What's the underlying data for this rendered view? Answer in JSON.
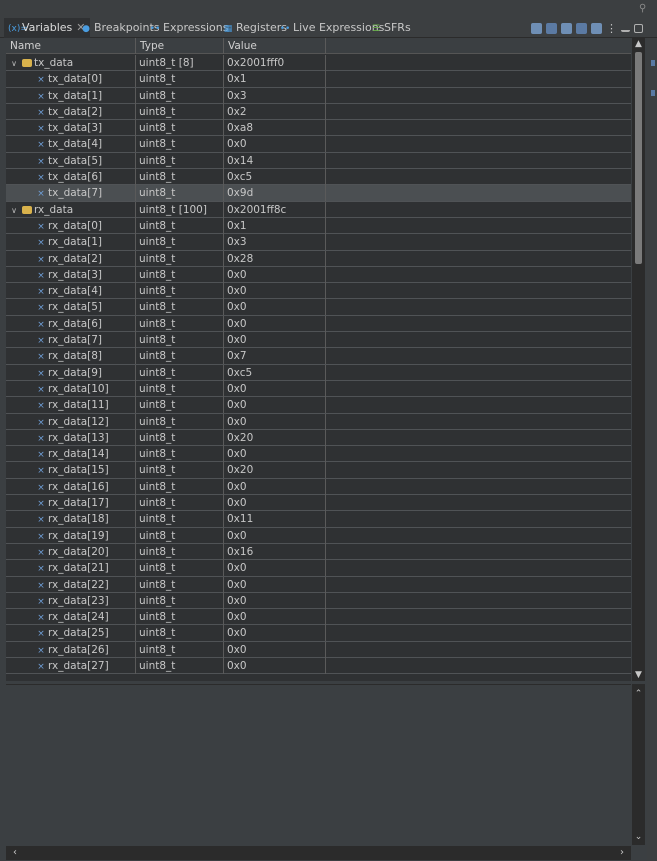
{
  "tabs": [
    {
      "label": "Variables",
      "icon": "variables-icon",
      "active": true
    },
    {
      "label": "Breakpoints",
      "icon": "breakpoints-icon",
      "active": false
    },
    {
      "label": "Expressions",
      "icon": "expressions-icon",
      "active": false
    },
    {
      "label": "Registers",
      "icon": "registers-icon",
      "active": false
    },
    {
      "label": "Live Expressions",
      "icon": "live-expressions-icon",
      "active": false
    },
    {
      "label": "SFRs",
      "icon": "sfrs-icon",
      "active": false
    }
  ],
  "columns": {
    "name": "Name",
    "type": "Type",
    "value": "Value"
  },
  "rows": [
    {
      "name": "tx_data",
      "type": "uint8_t [8]",
      "value": "0x2001fff0"
    },
    {
      "name": "tx_data[0]",
      "type": "uint8_t",
      "value": "0x1"
    },
    {
      "name": "tx_data[1]",
      "type": "uint8_t",
      "value": "0x3"
    },
    {
      "name": "tx_data[2]",
      "type": "uint8_t",
      "value": "0x2"
    },
    {
      "name": "tx_data[3]",
      "type": "uint8_t",
      "value": "0xa8"
    },
    {
      "name": "tx_data[4]",
      "type": "uint8_t",
      "value": "0x0"
    },
    {
      "name": "tx_data[5]",
      "type": "uint8_t",
      "value": "0x14"
    },
    {
      "name": "tx_data[6]",
      "type": "uint8_t",
      "value": "0xc5"
    },
    {
      "name": "tx_data[7]",
      "type": "uint8_t",
      "value": "0x9d"
    },
    {
      "name": "rx_data",
      "type": "uint8_t [100]",
      "value": "0x2001ff8c"
    },
    {
      "name": "rx_data[0]",
      "type": "uint8_t",
      "value": "0x1"
    },
    {
      "name": "rx_data[1]",
      "type": "uint8_t",
      "value": "0x3"
    },
    {
      "name": "rx_data[2]",
      "type": "uint8_t",
      "value": "0x28"
    },
    {
      "name": "rx_data[3]",
      "type": "uint8_t",
      "value": "0x0"
    },
    {
      "name": "rx_data[4]",
      "type": "uint8_t",
      "value": "0x0"
    },
    {
      "name": "rx_data[5]",
      "type": "uint8_t",
      "value": "0x0"
    },
    {
      "name": "rx_data[6]",
      "type": "uint8_t",
      "value": "0x0"
    },
    {
      "name": "rx_data[7]",
      "type": "uint8_t",
      "value": "0x0"
    },
    {
      "name": "rx_data[8]",
      "type": "uint8_t",
      "value": "0x7"
    },
    {
      "name": "rx_data[9]",
      "type": "uint8_t",
      "value": "0xc5"
    },
    {
      "name": "rx_data[10]",
      "type": "uint8_t",
      "value": "0x0"
    },
    {
      "name": "rx_data[11]",
      "type": "uint8_t",
      "value": "0x0"
    },
    {
      "name": "rx_data[12]",
      "type": "uint8_t",
      "value": "0x0"
    },
    {
      "name": "rx_data[13]",
      "type": "uint8_t",
      "value": "0x20"
    },
    {
      "name": "rx_data[14]",
      "type": "uint8_t",
      "value": "0x0"
    },
    {
      "name": "rx_data[15]",
      "type": "uint8_t",
      "value": "0x20"
    },
    {
      "name": "rx_data[16]",
      "type": "uint8_t",
      "value": "0x0"
    },
    {
      "name": "rx_data[17]",
      "type": "uint8_t",
      "value": "0x0"
    },
    {
      "name": "rx_data[18]",
      "type": "uint8_t",
      "value": "0x11"
    },
    {
      "name": "rx_data[19]",
      "type": "uint8_t",
      "value": "0x0"
    },
    {
      "name": "rx_data[20]",
      "type": "uint8_t",
      "value": "0x16"
    },
    {
      "name": "rx_data[21]",
      "type": "uint8_t",
      "value": "0x0"
    },
    {
      "name": "rx_data[22]",
      "type": "uint8_t",
      "value": "0x0"
    },
    {
      "name": "rx_data[23]",
      "type": "uint8_t",
      "value": "0x0"
    },
    {
      "name": "rx_data[24]",
      "type": "uint8_t",
      "value": "0x0"
    },
    {
      "name": "rx_data[25]",
      "type": "uint8_t",
      "value": "0x0"
    },
    {
      "name": "rx_data[26]",
      "type": "uint8_t",
      "value": "0x0"
    },
    {
      "name": "rx_data[27]",
      "type": "uint8_t",
      "value": "0x0"
    }
  ],
  "colors": {
    "panel": "#2f3133",
    "header": "#3b3f42",
    "selected_row": "#4b4f52",
    "pointer_icon": "#d9b24c",
    "element_icon": "#6f9fd8"
  }
}
